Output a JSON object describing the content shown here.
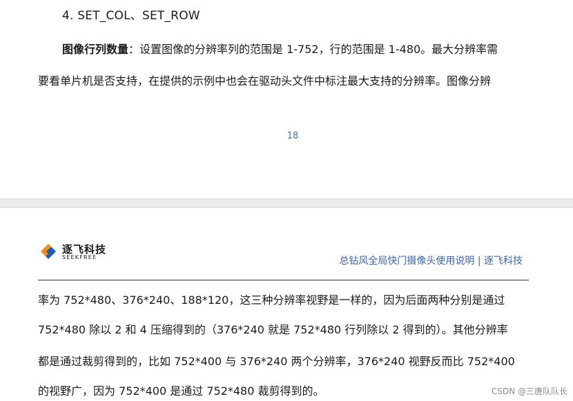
{
  "top_page": {
    "heading": "4.  SET_COL、SET_ROW",
    "paragraph": {
      "bold_lead": "图像行列数量",
      "line1_rest": "：设置图像的分辨率列的范围是 1-752，行的范围是 1-480。最大分辨率需",
      "line2": "要看单片机是否支持，在提供的示例中也会在驱动头文件中标注最大支持的分辨率。图像分辨"
    },
    "page_number": "18"
  },
  "bottom_page": {
    "logo": {
      "name_cn": "逐飞科技",
      "name_en": "SEEKFREE",
      "colors": {
        "orange": "#f08a1c",
        "blue": "#1d5fae"
      }
    },
    "header_title": "总钻风全局快门摄像头使用说明 | 逐飞科技",
    "body_lines": [
      "率为 752*480、376*240、188*120，这三种分辨率视野是一样的，因为后面两种分别是通过",
      "752*480 除以 2 和 4 压缩得到的（376*240 就是 752*480 行列除以 2 得到的）。其他分辨率",
      "都是通过裁剪得到的，比如 752*400 与 376*240 两个分辨率，376*240 视野反而比 752*400",
      "的视野广，因为 752*400 是通过 752*480 裁剪得到的。"
    ]
  },
  "watermark": "CSDN @三唐队队长"
}
